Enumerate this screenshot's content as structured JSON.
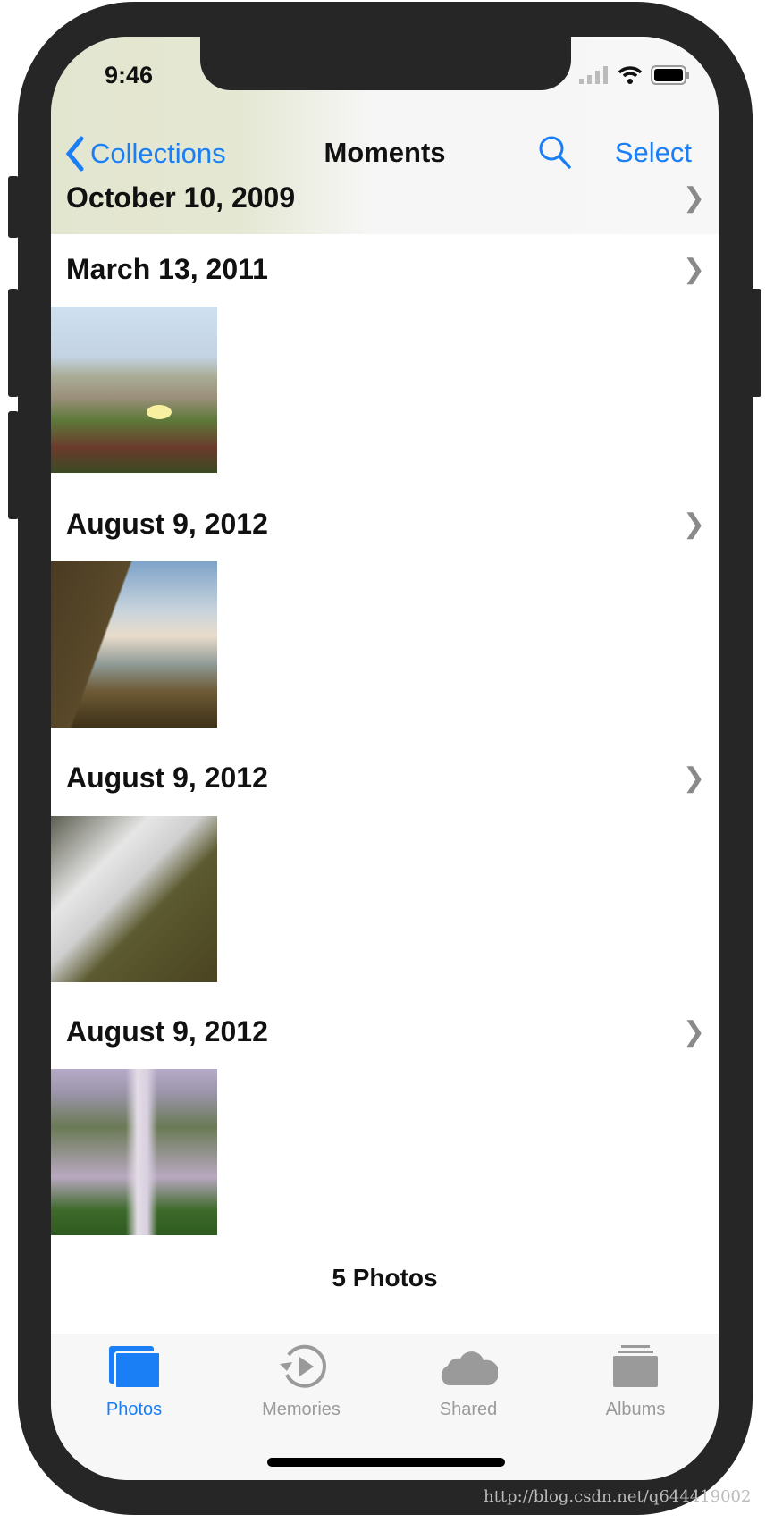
{
  "status": {
    "time": "9:46"
  },
  "nav": {
    "back_label": "Collections",
    "title": "Moments",
    "select_label": "Select"
  },
  "sections": [
    {
      "date": "October 10, 2009"
    },
    {
      "date": "March 13, 2011"
    },
    {
      "date": "August 9, 2012"
    },
    {
      "date": "August 9, 2012"
    },
    {
      "date": "August 9, 2012"
    }
  ],
  "footer": {
    "count": "5 Photos"
  },
  "tabs": [
    {
      "label": "Photos",
      "icon": "photos-icon",
      "active": true
    },
    {
      "label": "Memories",
      "icon": "memories-icon",
      "active": false
    },
    {
      "label": "Shared",
      "icon": "cloud-icon",
      "active": false
    },
    {
      "label": "Albums",
      "icon": "albums-icon",
      "active": false
    }
  ],
  "colors": {
    "accent": "#1a7ef5",
    "inactive": "#9a9a9a",
    "frame": "#262626"
  },
  "watermark": "http://blog.csdn.net/q644419002"
}
